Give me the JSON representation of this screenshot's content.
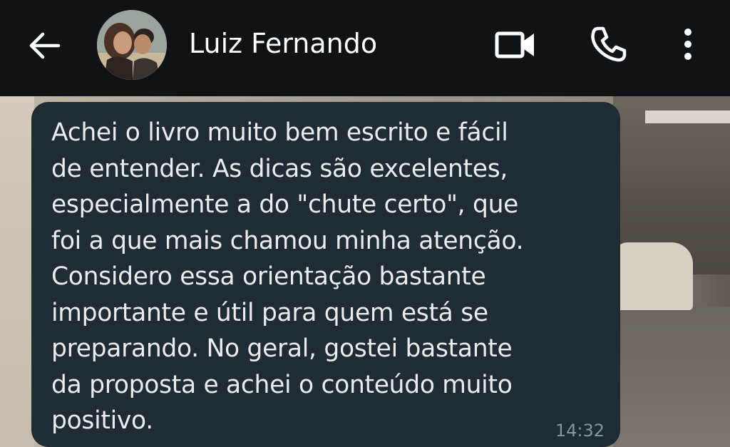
{
  "header": {
    "contact_name": "Luiz Fernando",
    "icons": {
      "back": "arrow-left-icon",
      "video": "video-call-icon",
      "call": "phone-icon",
      "menu": "more-vert-icon"
    }
  },
  "message": {
    "text": "Achei o livro muito bem escrito e fácil\nde entender. As dicas são excelentes,\nespecialmente a do \"chute certo\", que\nfoi a que mais chamou minha atenção.\nConsidero essa orientação bastante\nimportante e útil para quem está se\npreparando. No geral, gostei bastante\nda proposta e achei o conteúdo muito\npositivo.",
    "time": "14:32"
  },
  "colors": {
    "header_bg": "#0f1316",
    "bubble_bg": "#1f2c33",
    "message_text": "#e9edef",
    "timestamp": "#8696a0"
  }
}
